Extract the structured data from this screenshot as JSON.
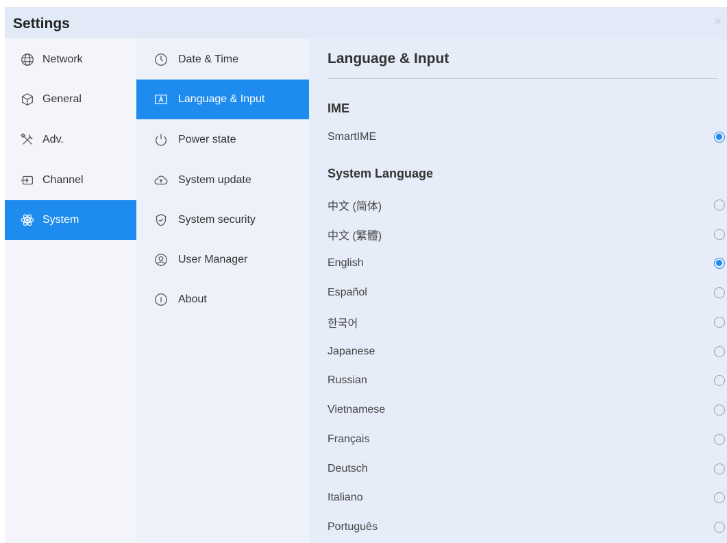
{
  "window": {
    "title": "Settings",
    "close_glyph": "×"
  },
  "categories": [
    {
      "label": "Network",
      "icon": "globe-icon",
      "active": false
    },
    {
      "label": "General",
      "icon": "cube-icon",
      "active": false
    },
    {
      "label": "Adv.",
      "icon": "tools-icon",
      "active": false
    },
    {
      "label": "Channel",
      "icon": "input-source-icon",
      "active": false
    },
    {
      "label": "System",
      "icon": "atom-icon",
      "active": true
    }
  ],
  "subsections": [
    {
      "label": "Date & Time",
      "icon": "clock-icon",
      "active": false
    },
    {
      "label": "Language & Input",
      "icon": "keyboard-a-icon",
      "active": true
    },
    {
      "label": "Power state",
      "icon": "power-icon",
      "active": false
    },
    {
      "label": "System update",
      "icon": "cloud-upload-icon",
      "active": false
    },
    {
      "label": "System security",
      "icon": "shield-check-icon",
      "active": false
    },
    {
      "label": "User Manager",
      "icon": "user-icon",
      "active": false
    },
    {
      "label": "About",
      "icon": "info-icon",
      "active": false
    }
  ],
  "panel": {
    "title": "Language & Input",
    "ime_section": "IME",
    "ime_options": [
      {
        "label": "SmartIME",
        "selected": true
      }
    ],
    "language_section": "System Language",
    "languages": [
      {
        "label": "中文 (简体)",
        "selected": false
      },
      {
        "label": "中文 (繁體)",
        "selected": false
      },
      {
        "label": "English",
        "selected": true
      },
      {
        "label": "Español",
        "selected": false
      },
      {
        "label": "한국어",
        "selected": false
      },
      {
        "label": "Japanese",
        "selected": false
      },
      {
        "label": "Russian",
        "selected": false
      },
      {
        "label": "Vietnamese",
        "selected": false
      },
      {
        "label": "Français",
        "selected": false
      },
      {
        "label": "Deutsch",
        "selected": false
      },
      {
        "label": "Italiano",
        "selected": false
      },
      {
        "label": "Português",
        "selected": false
      }
    ]
  },
  "colors": {
    "accent": "#1e8bee",
    "background": "#e9eef9"
  }
}
